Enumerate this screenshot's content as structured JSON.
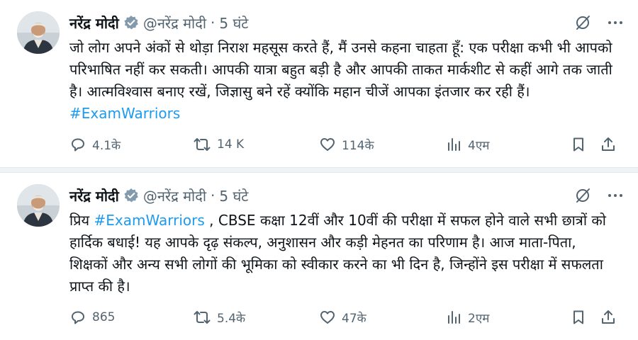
{
  "tweets": [
    {
      "author_name": "नरेंद्र मोदी",
      "handle": "@नरेंद्र मोदी",
      "separator": "·",
      "time": "5 घंटे",
      "text_before": "जो लोग अपने अंकों से थोड़ा निराश महसूस करते हैं, मैं उनसे कहना चाहता हूँ: एक परीक्षा कभी भी आपको परिभाषित नहीं कर सकती। आपकी यात्रा बहुत बड़ी है और आपकी ताकत मार्कशीट से कहीं आगे तक जाती है। आत्मविश्वास बनाए रखें, जिज्ञासु बने रहें क्योंकि महान चीजें आपका इंतजार कर रही हैं। ",
      "hashtag": "#ExamWarriors",
      "text_after": "",
      "replies": "4.1के",
      "reposts": "14 K",
      "likes": "114के",
      "views": "4एम"
    },
    {
      "author_name": "नरेंद्र मोदी",
      "handle": "@नरेंद्र मोदी",
      "separator": "·",
      "time": "5 घंटे",
      "text_before": "प्रिय ",
      "hashtag": "#ExamWarriors",
      "text_after": " , CBSE कक्षा 12वीं और 10वीं की परीक्षा में सफल होने वाले सभी छात्रों को हार्दिक बधाई! यह आपके दृढ़ संकल्प, अनुशासन और कड़ी मेहनत का परिणाम है। आज माता-पिता, शिक्षकों और अन्य सभी लोगों की भूमिका को स्वीकार करने का भी दिन है, जिन्होंने इस परीक्षा में सफलता प्राप्त की है।",
      "replies": "865",
      "reposts": "5.4के",
      "likes": "47के",
      "views": "2एम"
    }
  ],
  "colors": {
    "text": "#0f1419",
    "secondary": "#536471",
    "link": "#1d9bf0",
    "verified": "#829aab",
    "separator": "#eff3f4"
  },
  "icons": [
    "grok-icon",
    "more-icon",
    "reply-icon",
    "repost-icon",
    "like-icon",
    "views-icon",
    "bookmark-icon",
    "share-icon",
    "verified-icon"
  ]
}
